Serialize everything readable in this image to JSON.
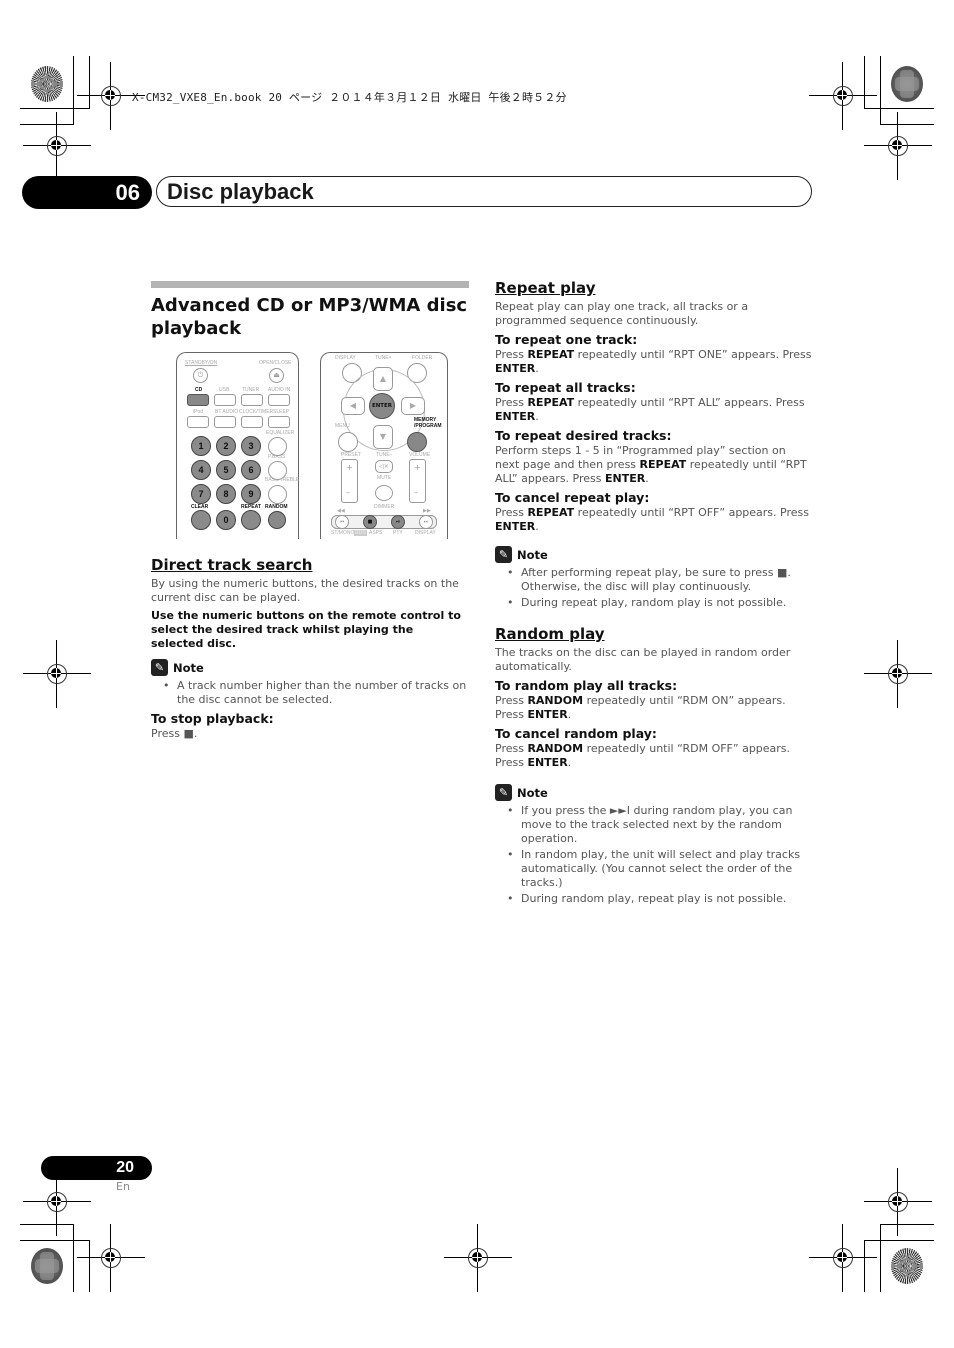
{
  "print_header": {
    "file_info": "X-CM32_VXE8_En.book  20 ページ  ２０１４年３月１２日  水曜日  午後２時５２分"
  },
  "chapter": {
    "number": "06",
    "title": "Disc playback"
  },
  "left_column": {
    "section_title_line1": "Advanced CD or MP3/WMA disc",
    "section_title_line2": "playback",
    "remote_a": {
      "labels": {
        "standby": "STANDBY/ON",
        "open_close": "OPEN/CLOSE",
        "cd": "CD",
        "usb": "USB",
        "tuner": "TUNER",
        "audio_in": "AUDIO IN",
        "ipod": "iPod",
        "bt_audio": "BT AUDIO",
        "clock_timer": "CLOCK/TIMER",
        "sleep": "SLEEP",
        "equalizer": "EQUALIZER",
        "pbass": "P.BASS",
        "bass_treble": "BASS/TREBLE",
        "clear": "CLEAR",
        "repeat": "REPEAT",
        "random": "RANDOM"
      },
      "numbers": [
        "1",
        "2",
        "3",
        "4",
        "5",
        "6",
        "7",
        "8",
        "9",
        "0"
      ],
      "power_glyph": "⏻",
      "eject_glyph": "⏏"
    },
    "remote_b": {
      "labels": {
        "display": "DISPLAY",
        "tune_plus": "TUNE+",
        "folder": "FOLDER",
        "enter": "ENTER",
        "menu": "MENU",
        "memory_program": "MEMORY /PROGRAM",
        "preset": "PRESET",
        "tune_minus": "TUNE–",
        "volume": "VOLUME",
        "mute": "MUTE",
        "dimmer": "DIMMER",
        "st_mono": "ST/MONO",
        "rds": "RDS",
        "asps": "ASPS",
        "pty": "PTY",
        "display2": "DISPLAY",
        "plus": "+",
        "minus": "–"
      },
      "glyphs": {
        "up": "▲",
        "down": "▼",
        "left": "◀",
        "right": "▶",
        "mute": "🔇",
        "prev": "⏮",
        "stop": "■",
        "play_pause": "⏯",
        "next": "⏭",
        "rew": "◀◀",
        "ff": "▶▶"
      }
    },
    "direct_track_search": {
      "title": "Direct track search",
      "intro": "By using the numeric buttons, the desired tracks on the current disc can be played.",
      "instruction": "Use the numeric buttons on the remote control to select the desired track whilst playing the selected disc.",
      "note_label": "Note",
      "notes": [
        "A track number higher than the number of tracks on the disc cannot be selected."
      ],
      "stop_heading": "To stop playback:",
      "stop_text": "Press ■."
    }
  },
  "right_column": {
    "repeat_play": {
      "title": "Repeat play",
      "intro": "Repeat play can play one track, all tracks or a programmed sequence continuously.",
      "steps": [
        {
          "heading": "To repeat one track:",
          "pre": "Press ",
          "key1": "REPEAT",
          "mid": " repeatedly until “RPT ONE” appears. Press ",
          "key2": "ENTER",
          "post": "."
        },
        {
          "heading": "To repeat all tracks:",
          "pre": "Press ",
          "key1": "REPEAT",
          "mid": " repeatedly until “RPT ALL” appears. Press ",
          "key2": "ENTER",
          "post": "."
        },
        {
          "heading": "To repeat desired tracks:",
          "pre": "Perform steps 1 - 5 in “Programmed play” section on next page and then press ",
          "key1": "REPEAT",
          "mid": " repeatedly until “RPT ALL” appears. Press ",
          "key2": "ENTER",
          "post": "."
        },
        {
          "heading": "To cancel repeat play:",
          "pre": "Press ",
          "key1": "REPEAT",
          "mid": " repeatedly until “RPT OFF” appears. Press ",
          "key2": "ENTER",
          "post": "."
        }
      ],
      "note_label": "Note",
      "notes": [
        "After performing repeat play, be sure to press ■. Otherwise, the disc will play continuously.",
        "During repeat play, random play is not possible."
      ]
    },
    "random_play": {
      "title": "Random play",
      "intro": "The tracks on the disc can be played in random order automatically.",
      "steps": [
        {
          "heading": "To random play all tracks:",
          "pre": "Press ",
          "key1": "RANDOM",
          "mid": " repeatedly until “RDM ON” appears. Press ",
          "key2": "ENTER",
          "post": "."
        },
        {
          "heading": "To cancel random play:",
          "pre": "Press ",
          "key1": "RANDOM",
          "mid": " repeatedly until “RDM OFF” appears. Press ",
          "key2": "ENTER",
          "post": "."
        }
      ],
      "note_label": "Note",
      "notes": [
        "If you press the ►►I during random play, you can move to the track selected next by the random operation.",
        "In random play, the unit will select and play tracks automatically. (You cannot select the order of the tracks.)",
        "During random play, repeat play is not possible."
      ]
    }
  },
  "footer": {
    "page_number": "20",
    "language": "En"
  }
}
